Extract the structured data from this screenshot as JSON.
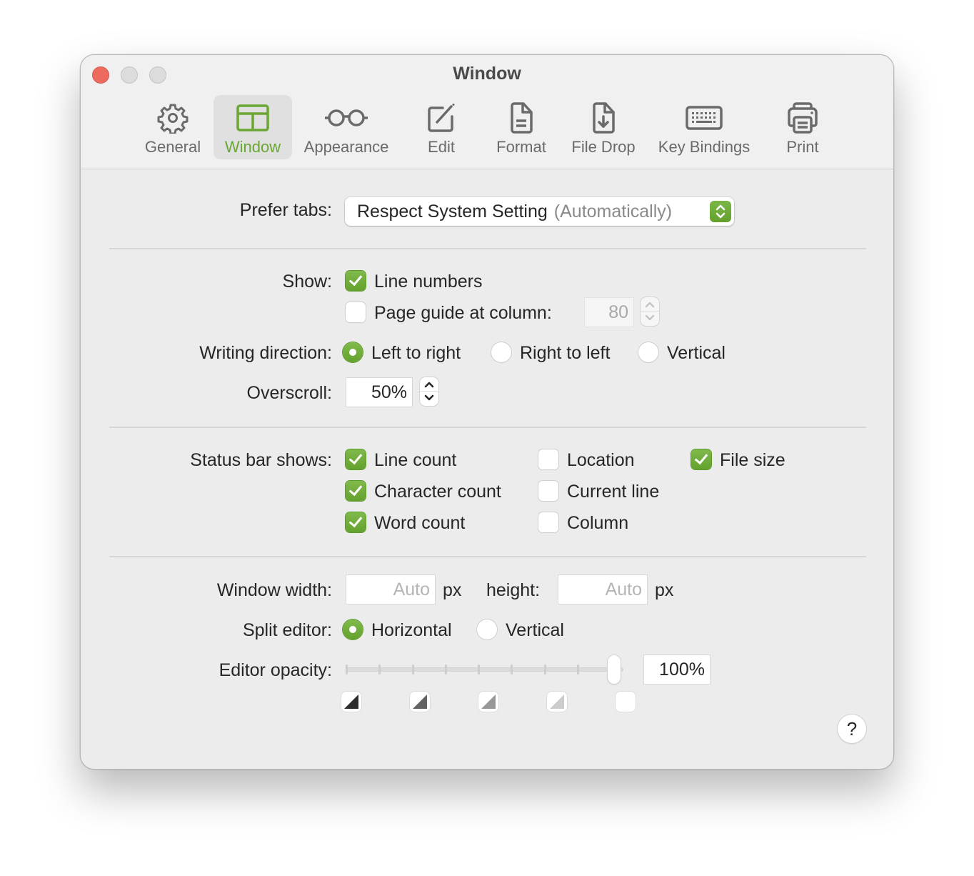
{
  "window": {
    "title": "Window"
  },
  "toolbar": {
    "items": [
      {
        "label": "General",
        "icon": "gear-icon",
        "selected": false
      },
      {
        "label": "Window",
        "icon": "window-layout-icon",
        "selected": true
      },
      {
        "label": "Appearance",
        "icon": "glasses-icon",
        "selected": false
      },
      {
        "label": "Edit",
        "icon": "pencil-square-icon",
        "selected": false
      },
      {
        "label": "Format",
        "icon": "document-text-icon",
        "selected": false
      },
      {
        "label": "File Drop",
        "icon": "document-arrow-down-icon",
        "selected": false
      },
      {
        "label": "Key Bindings",
        "icon": "keyboard-icon",
        "selected": false
      },
      {
        "label": "Print",
        "icon": "printer-icon",
        "selected": false
      }
    ]
  },
  "colors": {
    "accent": "#6aa633",
    "close": "#ec6a5e",
    "background": "#ececec"
  },
  "prefer_tabs": {
    "label": "Prefer tabs:",
    "value": "Respect System Setting",
    "value_secondary": "(Automatically)"
  },
  "show": {
    "label": "Show:",
    "line_numbers": {
      "label": "Line numbers",
      "checked": true
    },
    "page_guide": {
      "label": "Page guide at column:",
      "checked": false,
      "column": "80"
    }
  },
  "writing_direction": {
    "label": "Writing direction:",
    "options": [
      {
        "label": "Left to right",
        "selected": true
      },
      {
        "label": "Right to left",
        "selected": false
      },
      {
        "label": "Vertical",
        "selected": false
      }
    ]
  },
  "overscroll": {
    "label": "Overscroll:",
    "value": "50%"
  },
  "status_bar": {
    "label": "Status bar shows:",
    "items": [
      {
        "label": "Line count",
        "checked": true
      },
      {
        "label": "Character count",
        "checked": true
      },
      {
        "label": "Word count",
        "checked": true
      },
      {
        "label": "Location",
        "checked": false
      },
      {
        "label": "Current line",
        "checked": false
      },
      {
        "label": "Column",
        "checked": false
      },
      {
        "label": "File size",
        "checked": true
      }
    ]
  },
  "window_size": {
    "width_label": "Window width:",
    "width_placeholder": "Auto",
    "unit": "px",
    "height_label": "height:",
    "height_placeholder": "Auto"
  },
  "split_editor": {
    "label": "Split editor:",
    "options": [
      {
        "label": "Horizontal",
        "selected": true
      },
      {
        "label": "Vertical",
        "selected": false
      }
    ]
  },
  "editor_opacity": {
    "label": "Editor opacity:",
    "value": "100%",
    "slider_fraction": 1.0,
    "tick_count": 9,
    "presets": [
      "opacity-preset-20-icon",
      "opacity-preset-40-icon",
      "opacity-preset-60-icon",
      "opacity-preset-80-icon",
      "opacity-preset-100-icon"
    ]
  },
  "help": {
    "label": "?"
  }
}
